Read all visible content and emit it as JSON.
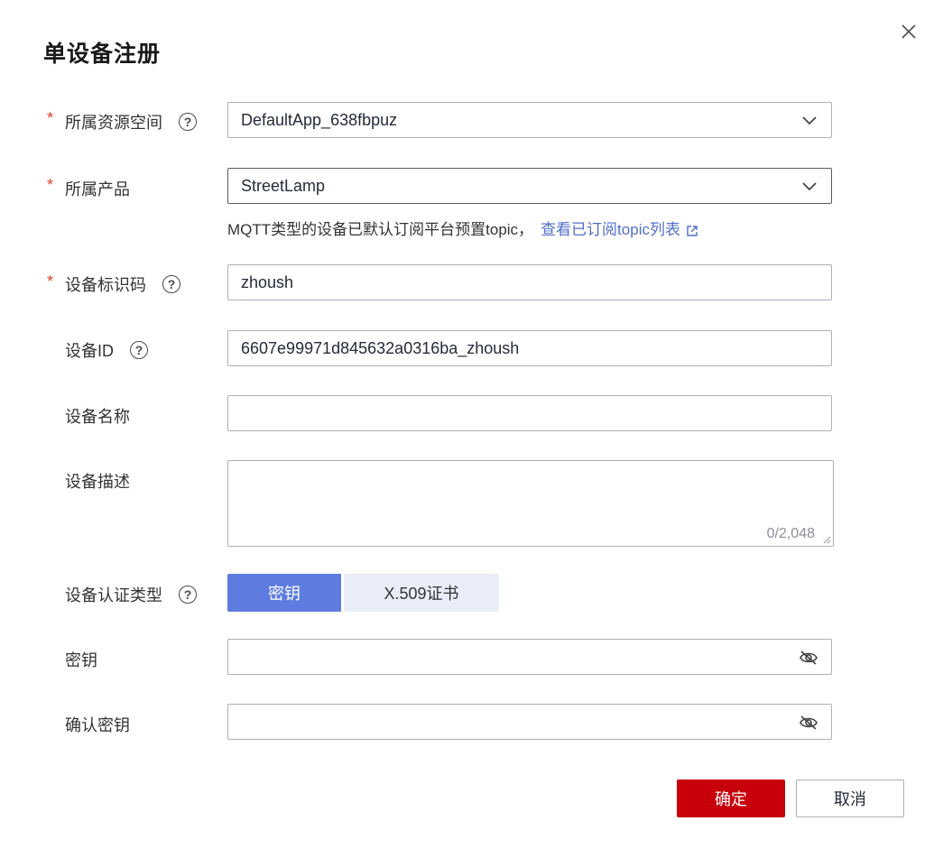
{
  "dialog": {
    "title": "单设备注册",
    "fields": {
      "resource_space": {
        "label": "所属资源空间",
        "value": "DefaultApp_638fbpuz"
      },
      "product": {
        "label": "所属产品",
        "value": "StreetLamp"
      },
      "hint": {
        "text": "MQTT类型的设备已默认订阅平台预置topic，",
        "link": "查看已订阅topic列表"
      },
      "node_id": {
        "label": "设备标识码",
        "value": "zhoush"
      },
      "device_id": {
        "label": "设备ID",
        "value": "6607e99971d845632a0316ba_zhoush"
      },
      "device_name": {
        "label": "设备名称",
        "value": ""
      },
      "description": {
        "label": "设备描述",
        "value": "",
        "counter": "0/2,048"
      },
      "auth_type": {
        "label": "设备认证类型",
        "options": [
          "密钥",
          "X.509证书"
        ],
        "selected": "密钥"
      },
      "secret": {
        "label": "密钥",
        "value": ""
      },
      "confirm_secret": {
        "label": "确认密钥",
        "value": ""
      }
    },
    "buttons": {
      "ok": "确定",
      "cancel": "取消"
    },
    "required_mark": "*",
    "help_mark": "?",
    "colors": {
      "primary": "#c7000b",
      "accent": "#5e7ce0",
      "link": "#526ecc",
      "required": "#e0412c"
    }
  }
}
